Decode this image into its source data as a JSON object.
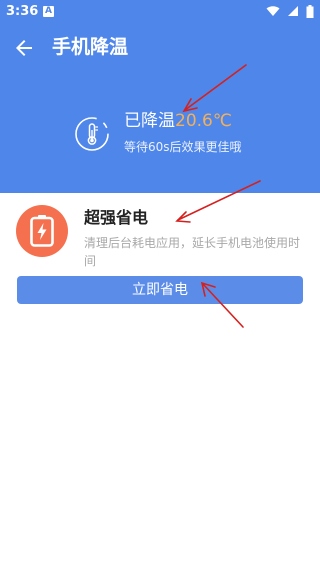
{
  "status_bar": {
    "time": "3:36",
    "notification_glyph": "A"
  },
  "app_bar": {
    "title": "手机降温"
  },
  "temperature": {
    "prefix": "已降温",
    "value": "20.6℃",
    "subtitle": "等待60s后效果更佳哦"
  },
  "card": {
    "title": "超强省电",
    "description": "清理后台耗电应用，延长手机电池使用时间"
  },
  "button": {
    "label": "立即省电"
  },
  "colors": {
    "header_bg": "#4f86ea",
    "accent_orange": "#f2b05a",
    "battery_bg": "#f5704e",
    "button_bg": "#5b8de8",
    "annotation_red": "#d6201e"
  },
  "icons": [
    "back-arrow-icon",
    "thermometer-icon",
    "battery-charging-icon",
    "wifi-icon",
    "signal-icon",
    "battery-icon"
  ]
}
